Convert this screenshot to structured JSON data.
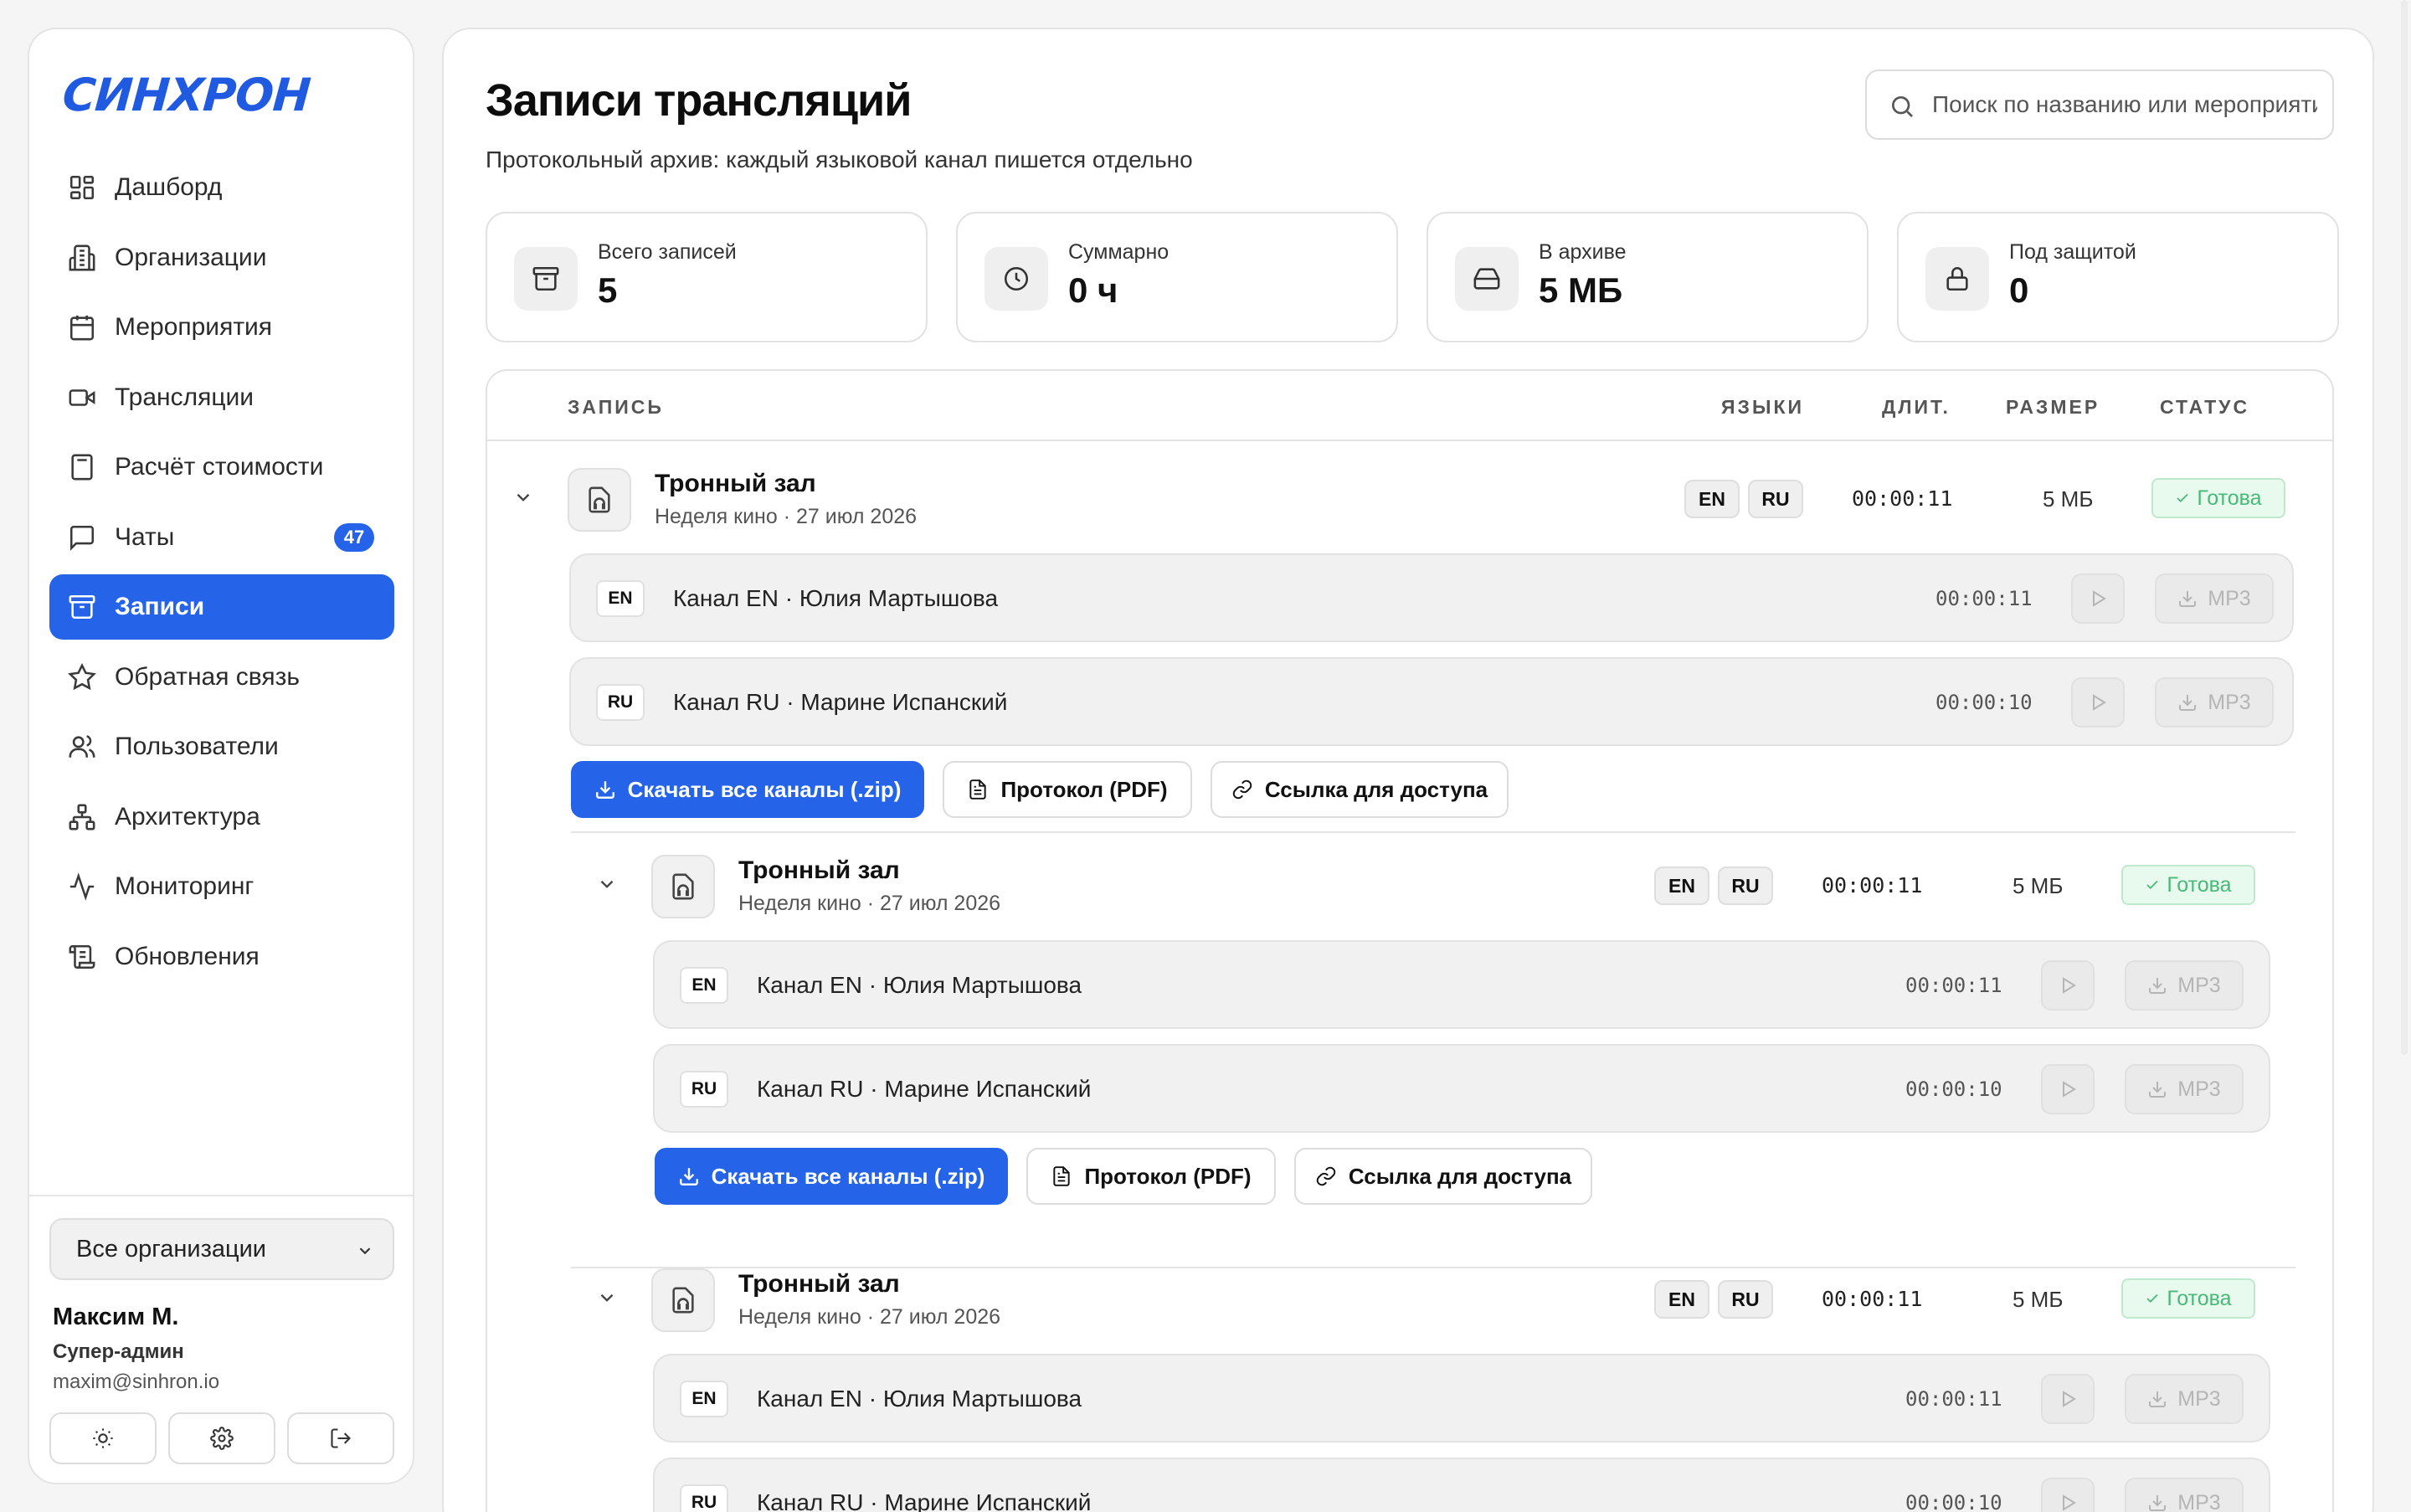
{
  "app": {
    "logo_text": "СИНХРОН"
  },
  "sidebar": {
    "items": [
      {
        "label": "Дашборд",
        "icon": "dashboard-icon"
      },
      {
        "label": "Организации",
        "icon": "building-icon"
      },
      {
        "label": "Мероприятия",
        "icon": "calendar-icon"
      },
      {
        "label": "Трансляции",
        "icon": "video-icon"
      },
      {
        "label": "Расчёт стоимости",
        "icon": "calculator-icon"
      },
      {
        "label": "Чаты",
        "icon": "chat-icon",
        "badge": "47"
      },
      {
        "label": "Записи",
        "icon": "archive-icon",
        "active": true
      },
      {
        "label": "Обратная связь",
        "icon": "star-icon"
      },
      {
        "label": "Пользователи",
        "icon": "users-icon"
      },
      {
        "label": "Архитектура",
        "icon": "network-icon"
      },
      {
        "label": "Мониторинг",
        "icon": "activity-icon"
      },
      {
        "label": "Обновления",
        "icon": "scroll-icon"
      }
    ],
    "org_select": "Все организации",
    "user": {
      "name": "Максим М.",
      "role": "Супер-админ",
      "email": "maxim@sinhron.io"
    }
  },
  "page": {
    "title": "Записи трансляций",
    "subtitle": "Протокольный архив: каждый языковой канал пишется отдельно",
    "search_placeholder": "Поиск по названию или мероприятию"
  },
  "stats": [
    {
      "label": "Всего записей",
      "value": "5",
      "icon": "archive-icon"
    },
    {
      "label": "Суммарно",
      "value": "0 ч",
      "icon": "clock-icon"
    },
    {
      "label": "В архиве",
      "value": "5 МБ",
      "icon": "drive-icon"
    },
    {
      "label": "Под защитой",
      "value": "0",
      "icon": "lock-icon"
    }
  ],
  "table": {
    "headers": {
      "record": "ЗАПИСЬ",
      "langs": "ЯЗЫКИ",
      "duration": "ДЛИТ.",
      "size": "РАЗМЕР",
      "status": "СТАТУС"
    }
  },
  "records": [
    {
      "title": "Тронный зал",
      "meta": "Неделя кино · 27 июл 2026",
      "langs": [
        "EN",
        "RU"
      ],
      "duration": "00:00:11",
      "size": "5 МБ",
      "status": "Готова",
      "channels": [
        {
          "code": "EN",
          "name": "Канал EN · Юлия Мартышова",
          "duration": "00:00:11",
          "download": "MP3"
        },
        {
          "code": "RU",
          "name": "Канал RU · Марине Испанский",
          "duration": "00:00:10",
          "download": "MP3"
        }
      ],
      "actions": {
        "zip": "Скачать все каналы (.zip)",
        "pdf": "Протокол (PDF)",
        "link": "Ссылка для доступа"
      }
    },
    {
      "title": "Тронный зал",
      "meta": "Неделя кино · 27 июл 2026",
      "langs": [
        "EN",
        "RU"
      ],
      "duration": "00:00:11",
      "size": "5 МБ",
      "status": "Готова",
      "channels": [
        {
          "code": "EN",
          "name": "Канал EN · Юлия Мартышова",
          "duration": "00:00:11",
          "download": "MP3"
        },
        {
          "code": "RU",
          "name": "Канал RU · Марине Испанский",
          "duration": "00:00:10",
          "download": "MP3"
        }
      ],
      "actions": {
        "zip": "Скачать все каналы (.zip)",
        "pdf": "Протокол (PDF)",
        "link": "Ссылка для доступа"
      }
    },
    {
      "title": "Тронный зал",
      "meta": "Неделя кино · 27 июл 2026",
      "langs": [
        "EN",
        "RU"
      ],
      "duration": "00:00:11",
      "size": "5 МБ",
      "status": "Готова",
      "channels": [
        {
          "code": "EN",
          "name": "Канал EN · Юлия Мартышова",
          "duration": "00:00:11",
          "download": "MP3"
        },
        {
          "code": "RU",
          "name": "Канал RU · Марине Испанский",
          "duration": "00:00:10",
          "download": "MP3"
        }
      ]
    }
  ]
}
